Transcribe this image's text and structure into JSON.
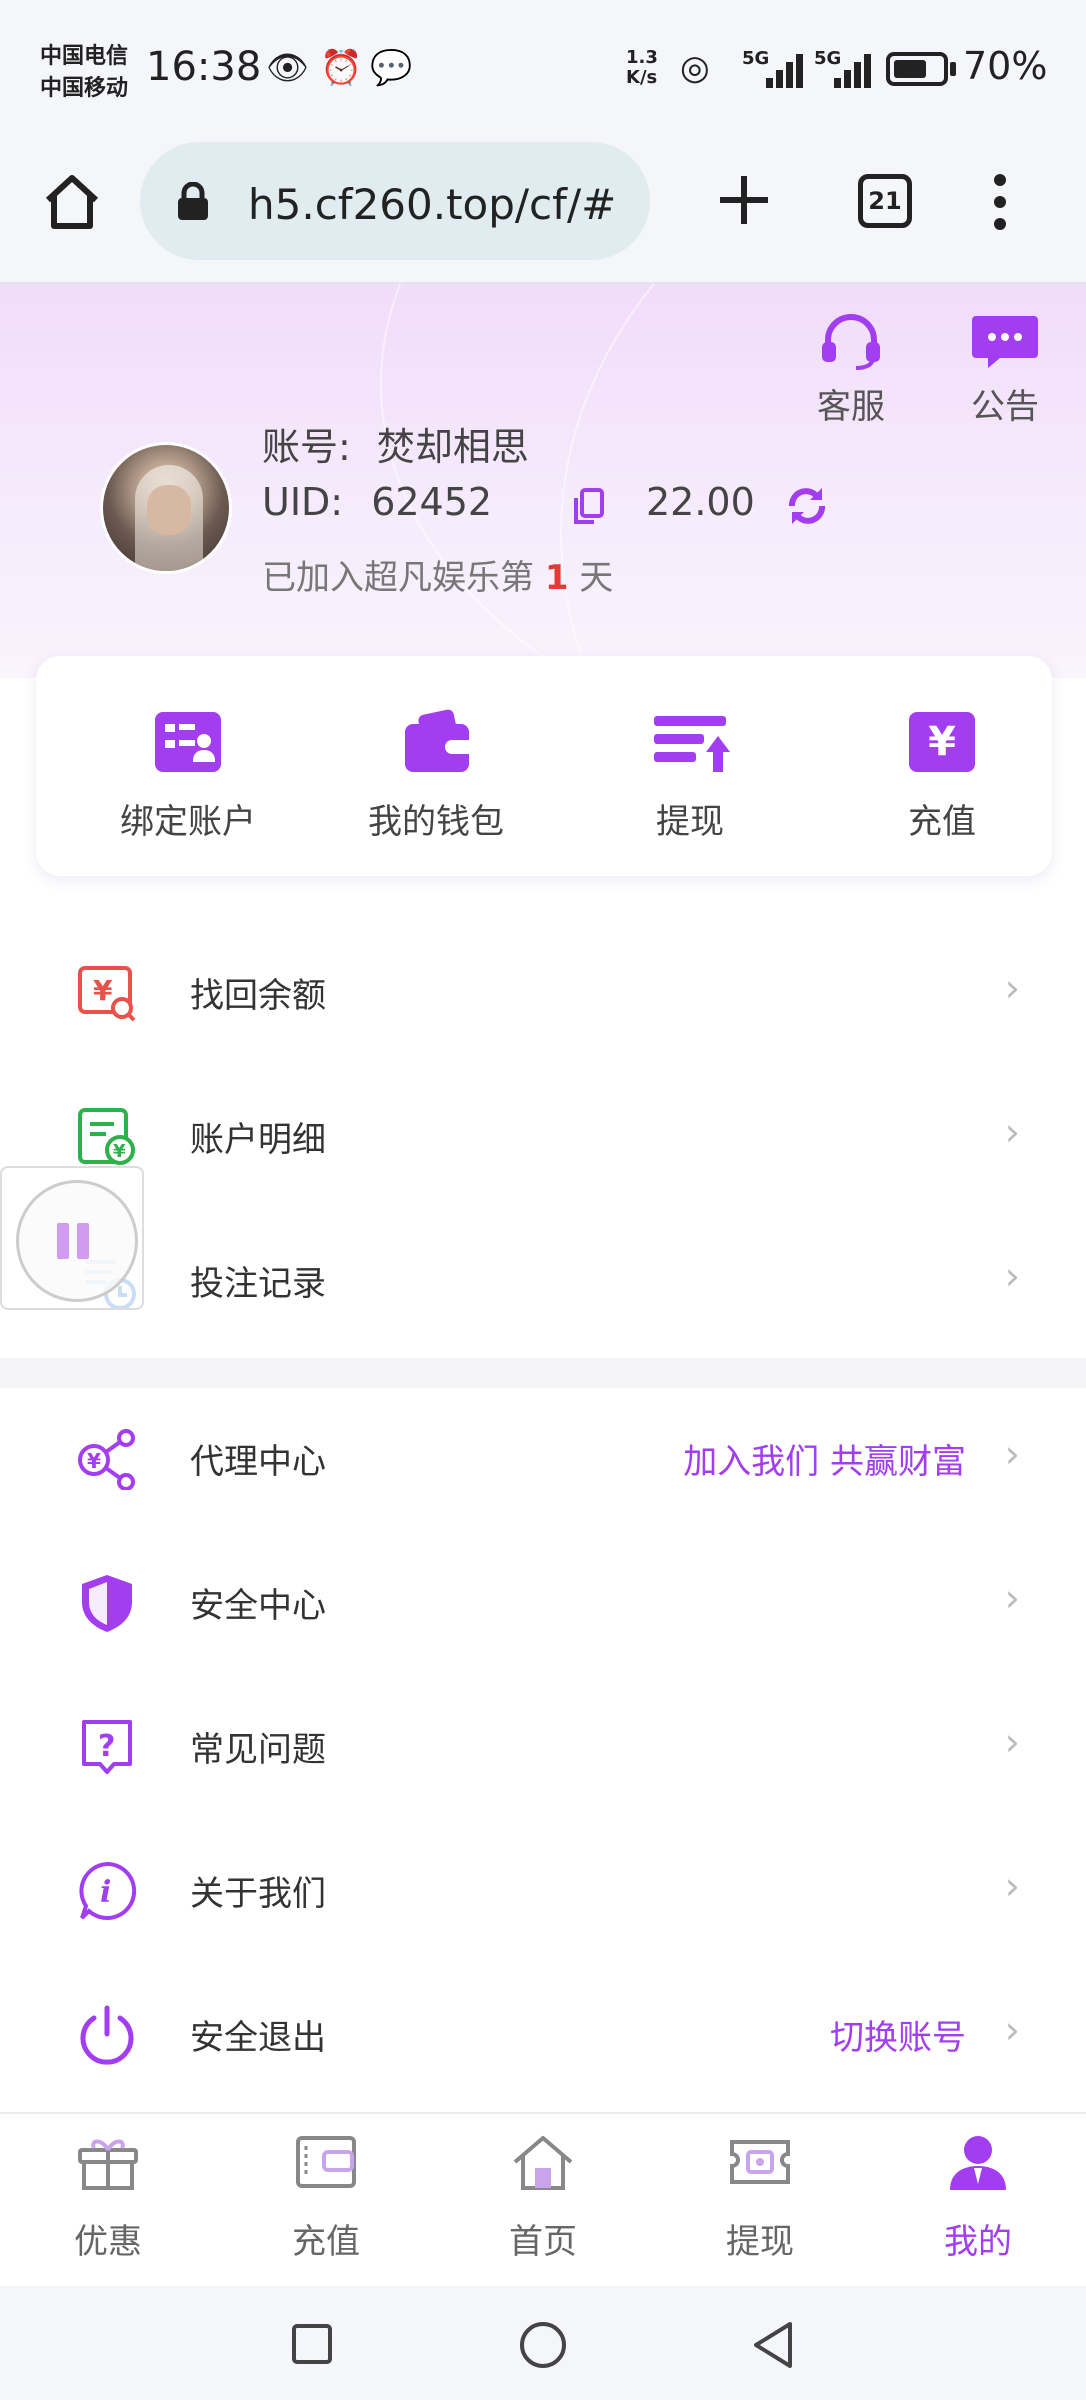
{
  "status_bar": {
    "carrier1": "中国电信",
    "carrier2": "中国移动",
    "time": "16:38",
    "net_speed_value": "1.3",
    "net_speed_unit": "K/s",
    "net_type1": "5G",
    "net_type2": "5G",
    "battery_level": 0.7,
    "battery_text": "70%"
  },
  "browser": {
    "url": "h5.cf260.top/cf/#",
    "tab_count": "21"
  },
  "header": {
    "service_label": "客服",
    "notice_label": "公告",
    "account_label": "账号:",
    "account_name": "焚却相思",
    "uid_label": "UID:",
    "uid_value": "62452",
    "balance": "22.00",
    "join_prefix": "已加入超凡娱乐第",
    "join_days": "1",
    "join_suffix": "天"
  },
  "quick_actions": [
    {
      "label": "绑定账户",
      "icon": "id-card-icon"
    },
    {
      "label": "我的钱包",
      "icon": "wallet-icon"
    },
    {
      "label": "提现",
      "icon": "withdraw-icon"
    },
    {
      "label": "充值",
      "icon": "yuan-icon"
    }
  ],
  "menu_group1": [
    {
      "label": "找回余额",
      "icon": "recover-balance-icon"
    },
    {
      "label": "账户明细",
      "icon": "account-detail-icon"
    },
    {
      "label": "投注记录",
      "icon": "bet-record-icon"
    }
  ],
  "menu_group2": [
    {
      "label": "代理中心",
      "extra": "加入我们 共赢财富",
      "icon": "share-icon"
    },
    {
      "label": "安全中心",
      "extra": "",
      "icon": "shield-icon"
    },
    {
      "label": "常见问题",
      "extra": "",
      "icon": "question-icon"
    },
    {
      "label": "关于我们",
      "extra": "",
      "icon": "info-icon"
    },
    {
      "label": "安全退出",
      "extra": "切换账号",
      "icon": "power-icon"
    }
  ],
  "tab_bar": [
    {
      "label": "优惠",
      "icon": "gift-icon"
    },
    {
      "label": "充值",
      "icon": "wallet-card-icon"
    },
    {
      "label": "首页",
      "icon": "home-icon"
    },
    {
      "label": "提现",
      "icon": "cash-icon"
    },
    {
      "label": "我的",
      "icon": "user-icon",
      "active": true
    }
  ],
  "colors": {
    "accent": "#a23df0",
    "join_days": "#e53935"
  }
}
